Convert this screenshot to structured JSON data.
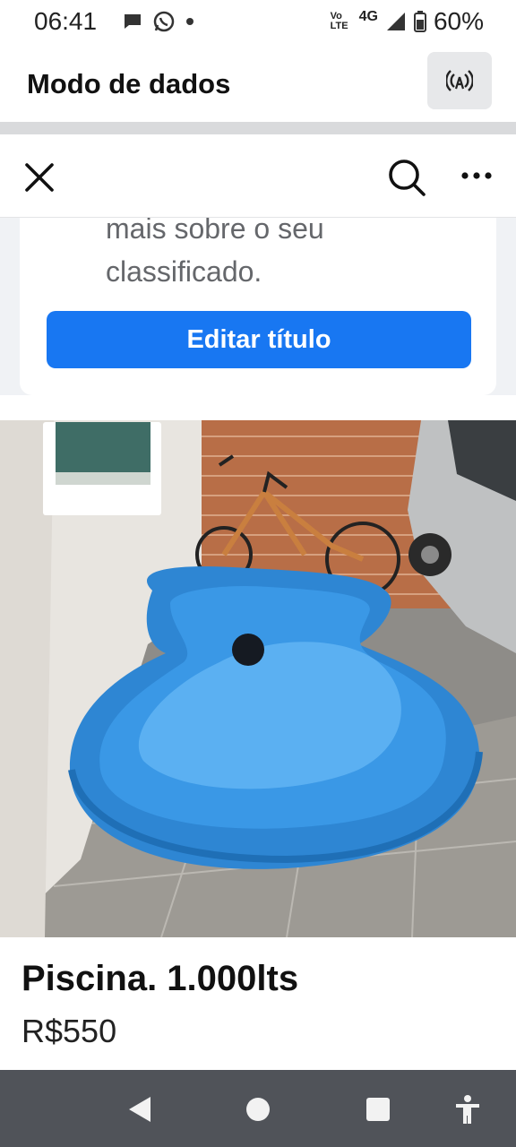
{
  "status_bar": {
    "time": "06:41",
    "network_volte": "Vo LTE",
    "network_type": "4G",
    "battery": "60%"
  },
  "data_mode": {
    "title": "Modo de dados",
    "icon": "broadcast-icon"
  },
  "toolbar": {
    "close_icon": "close-icon",
    "search_icon": "search-icon",
    "more_icon": "more-icon"
  },
  "card": {
    "text_partial": "mais sobre o seu",
    "text_line": "classificado.",
    "edit_button": "Editar título",
    "button_color": "#1877f2"
  },
  "listing": {
    "title": "Piscina. 1.000lts",
    "price": "R$550"
  },
  "nav_bar": {
    "back_icon": "back-icon",
    "home_icon": "home-icon",
    "recents_icon": "recents-icon",
    "accessibility_icon": "accessibility-icon"
  }
}
